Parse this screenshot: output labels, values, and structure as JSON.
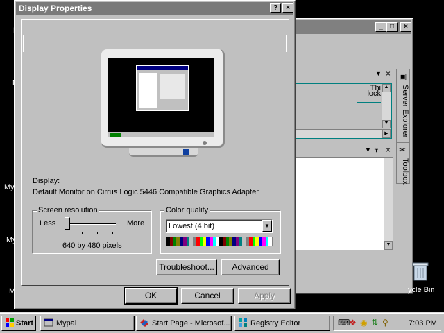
{
  "desktop": {
    "edge_letters": [
      "M",
      "N",
      "My",
      "My",
      "M"
    ]
  },
  "background_window": {
    "tool_windows": {
      "server_explorer_label": "Server Explorer",
      "toolbox_label": "Toolbox"
    },
    "pane_text_fragments": [
      "Thi",
      "lock"
    ]
  },
  "recycle_bin": {
    "label": "ycle Bin"
  },
  "dialog": {
    "title": "Display Properties",
    "help_button": "?",
    "close_button": "×",
    "display_label": "Display:",
    "display_value": "Default Monitor on Cirrus Logic 5446 Compatible Graphics Adapter",
    "screen_resolution": {
      "legend": "Screen resolution",
      "less_label": "Less",
      "more_label": "More",
      "value_text": "640 by 480 pixels",
      "slider_position_fraction": 0.0
    },
    "color_quality": {
      "legend": "Color quality",
      "selected": "Lowest (4 bit)",
      "palette": [
        "#000000",
        "#800000",
        "#008000",
        "#808000",
        "#000080",
        "#800080",
        "#008080",
        "#c0c0c0",
        "#808080",
        "#ff0000",
        "#00ff00",
        "#ffff00",
        "#0000ff",
        "#ff00ff",
        "#00ffff",
        "#ffffff",
        "#000000",
        "#800000",
        "#008000",
        "#808000",
        "#000080",
        "#800080",
        "#008080",
        "#c0c0c0",
        "#808080",
        "#ff0000",
        "#00ff00",
        "#ffff00",
        "#0000ff",
        "#ff00ff",
        "#00ffff",
        "#ffffff"
      ]
    },
    "troubleshoot_label": "Troubleshoot...",
    "advanced_label": "Advanced",
    "ok_label": "OK",
    "cancel_label": "Cancel",
    "apply_label": "Apply"
  },
  "taskbar": {
    "start_label": "Start",
    "tasks": [
      {
        "label": "Mypal"
      },
      {
        "label": "Start Page - Microsof..."
      },
      {
        "label": "Registry Editor"
      }
    ],
    "clock": "7:03 PM"
  },
  "colors": {
    "desktop": "#000000",
    "face": "#c0c0c0",
    "inactive_title": "#7a7a7a",
    "accent_teal": "#008080"
  }
}
